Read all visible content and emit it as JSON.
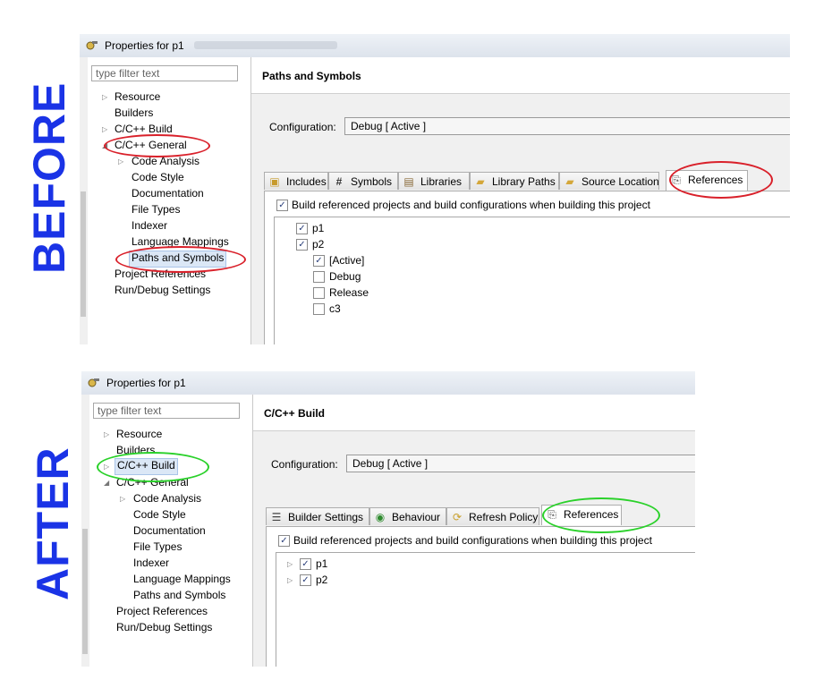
{
  "labels": {
    "before": "BEFORE",
    "after": "AFTER"
  },
  "colors": {
    "label_blue": "#1a33e6",
    "oval_red": "#d9202a",
    "oval_green": "#2ad12a",
    "selection": "#dbe7f6"
  },
  "before": {
    "window_title": "Properties for p1",
    "filter_placeholder": "type filter text",
    "nav": [
      "Resource",
      "Builders",
      "C/C++ Build",
      "C/C++ General",
      "Code Analysis",
      "Code Style",
      "Documentation",
      "File Types",
      "Indexer",
      "Language Mappings",
      "Paths and Symbols",
      "Project References",
      "Run/Debug Settings"
    ],
    "page_title": "Paths and Symbols",
    "config_label": "Configuration:",
    "config_value": "Debug  [ Active ]",
    "tabs": [
      {
        "label": "Includes",
        "icon": "includes-icon"
      },
      {
        "label": "Symbols",
        "icon": "hash-icon"
      },
      {
        "label": "Libraries",
        "icon": "libraries-icon"
      },
      {
        "label": "Library Paths",
        "icon": "folder-icon"
      },
      {
        "label": "Source Location",
        "icon": "folder-icon"
      },
      {
        "label": "References",
        "icon": "references-icon"
      }
    ],
    "build_ref_label": "Build referenced projects and build configurations when building this project",
    "refs": [
      "p1",
      "p2",
      "[Active]",
      "Debug",
      "Release",
      "c3"
    ]
  },
  "after": {
    "window_title": "Properties for p1",
    "filter_placeholder": "type filter text",
    "nav": [
      "Resource",
      "Builders",
      "C/C++ Build",
      "C/C++ General",
      "Code Analysis",
      "Code Style",
      "Documentation",
      "File Types",
      "Indexer",
      "Language Mappings",
      "Paths and Symbols",
      "Project References",
      "Run/Debug Settings"
    ],
    "page_title": "C/C++ Build",
    "config_label": "Configuration:",
    "config_value": "Debug  [ Active ]",
    "tabs": [
      {
        "label": "Builder Settings",
        "icon": "list-icon"
      },
      {
        "label": "Behaviour",
        "icon": "radio-icon"
      },
      {
        "label": "Refresh Policy",
        "icon": "refresh-icon"
      },
      {
        "label": "References",
        "icon": "references-icon"
      }
    ],
    "build_ref_label": "Build referenced projects and build configurations when building this project",
    "refs": [
      "p1",
      "p2"
    ]
  }
}
